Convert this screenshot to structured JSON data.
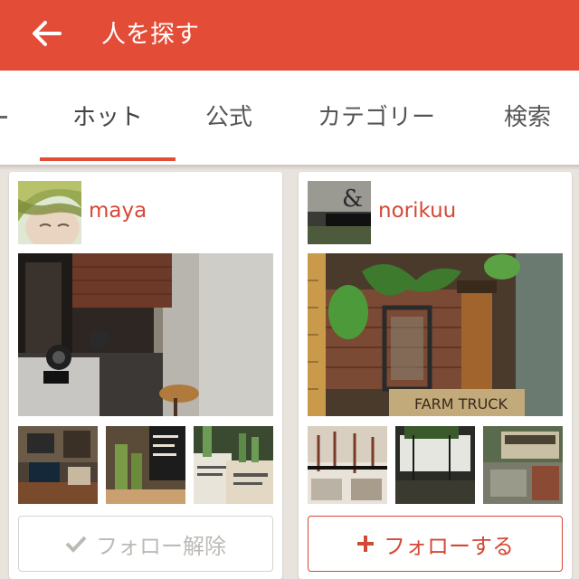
{
  "appbar": {
    "title": "人を探す",
    "back_icon": "arrow-left-icon",
    "color": "#e34c36"
  },
  "tabs": [
    {
      "label": "ホット",
      "active": true
    },
    {
      "label": "公式",
      "active": false
    },
    {
      "label": "カテゴリー",
      "active": false
    },
    {
      "label": "検索",
      "active": false
    }
  ],
  "users": [
    {
      "name": "maya",
      "button_label": "フォロー解除",
      "button_icon": "check-icon",
      "following": true
    },
    {
      "name": "norikuu",
      "avatar_text": "norikuu",
      "button_label": "フォローする",
      "button_icon": "plus-icon",
      "following": false
    }
  ],
  "photo_text": {
    "truck_sign": "FARM TRUCK",
    "ampersand": "&"
  }
}
